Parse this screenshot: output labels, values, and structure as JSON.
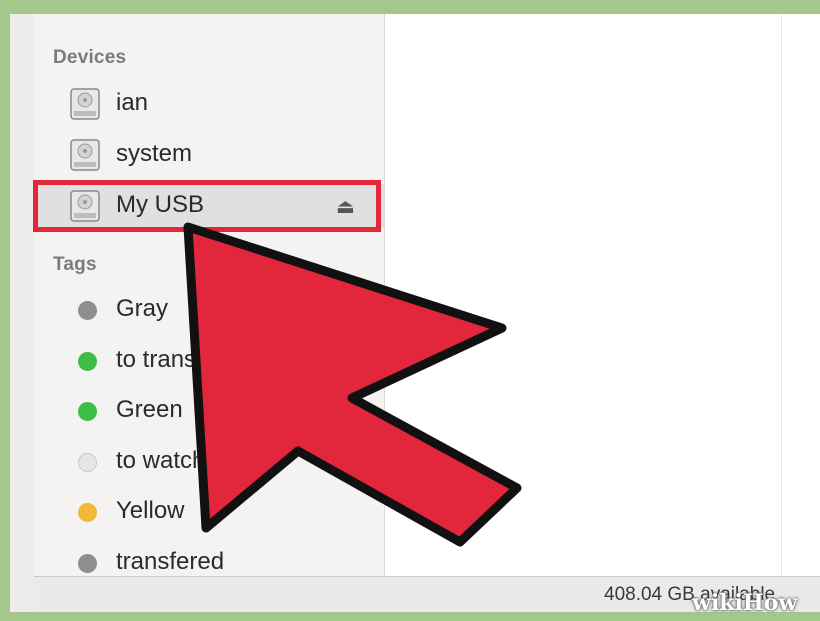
{
  "sidebar": {
    "devices_header": "Devices",
    "devices": [
      {
        "label": "ian",
        "icon": "hard-drive-icon"
      },
      {
        "label": "system",
        "icon": "hard-drive-icon"
      },
      {
        "label": "My USB",
        "icon": "hard-drive-icon",
        "eject": "⏏",
        "selected": true
      }
    ],
    "tags_header": "Tags",
    "tags": [
      {
        "label": "Gray",
        "color": "#8e8e8e"
      },
      {
        "label": "to transfer",
        "color": "#3ebd44"
      },
      {
        "label": "Green",
        "color": "#3ebd44"
      },
      {
        "label": "to watch",
        "color": "#e4e4e4"
      },
      {
        "label": "Yellow",
        "color": "#f0b93a"
      },
      {
        "label": "transfered",
        "color": "#8e8e8e"
      }
    ]
  },
  "statusbar": {
    "text": "408.04 GB available"
  },
  "annotation": {
    "highlight_color": "#e2263c",
    "arrow_color": "#e2263c"
  },
  "watermark": {
    "text": "wikiHow"
  }
}
